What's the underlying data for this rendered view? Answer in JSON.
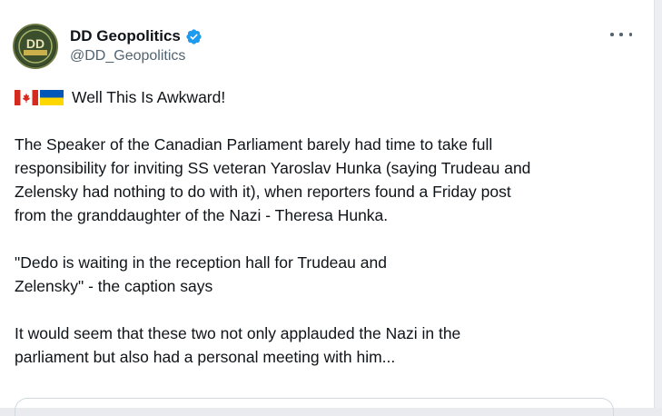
{
  "author": {
    "display_name": "DD Geopolitics",
    "handle": "@DD_Geopolitics",
    "avatar_text": "DD",
    "verified_icon": "verified-badge-icon",
    "verified_color": "#1d9bf0"
  },
  "menu": {
    "icon": "more-options-icon"
  },
  "tweet": {
    "flag_icons": [
      "canada-flag-icon",
      "ukraine-flag-icon"
    ],
    "headline": "Well This Is Awkward!",
    "paragraph_1": "The Speaker of the Canadian Parliament barely had time to take full\nresponsibility for inviting SS veteran Yaroslav Hunka (saying Trudeau and\nZelensky had nothing to do with it), when reporters found a Friday post\nfrom the granddaughter of the Nazi - Theresa Hunka.",
    "paragraph_2": "\"Dedo is waiting in the reception hall for Trudeau and\nZelensky\" - the caption says",
    "paragraph_3": "It would seem that these two not only applauded the Nazi in the\nparliament but also had a personal meeting with him..."
  }
}
